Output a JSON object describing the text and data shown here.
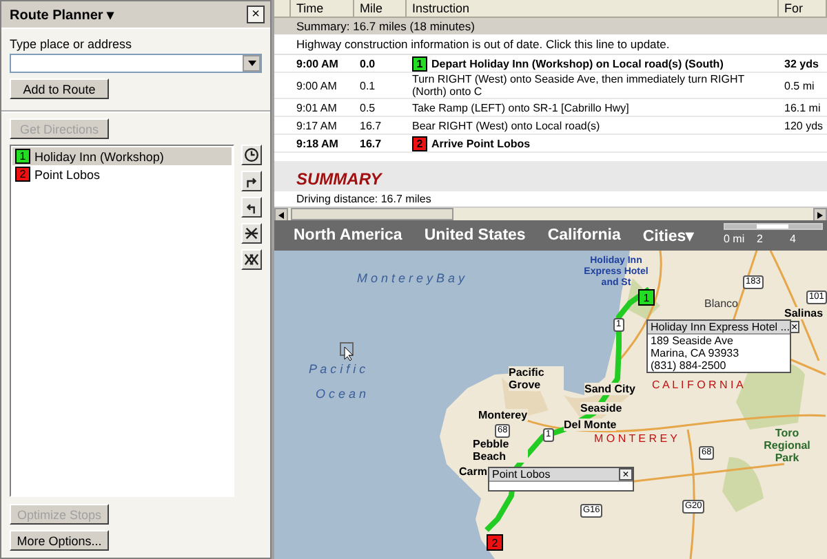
{
  "planner": {
    "title": "Route Planner",
    "menu_caret": "▾",
    "close": "×",
    "field_label": "Type place or address",
    "add_button": {
      "label": "Add to Route",
      "disabled": false
    },
    "directions_button": {
      "label": "Get Directions",
      "disabled": true
    },
    "stops": [
      {
        "number": "1",
        "name": "Holiday Inn (Workshop)",
        "color": "#22dd22",
        "selected": true
      },
      {
        "number": "2",
        "name": "Point Lobos",
        "color": "#ee1111",
        "selected": false
      }
    ],
    "bottom_buttons": [
      {
        "label": "Optimize Stops",
        "disabled": true
      },
      {
        "label": "More Options...",
        "disabled": false
      }
    ]
  },
  "directions": {
    "columns": [
      "Time",
      "Mile",
      "Instruction",
      "For"
    ],
    "summary": "Summary:  16.7 miles (18 minutes)",
    "notice": "Highway construction information is out of date.  Click this line to update.",
    "rows": [
      {
        "kind": "stop",
        "time": "9:00 AM",
        "mile": "0.0",
        "marker": "1",
        "color": "#22dd22",
        "instruction": "Depart Holiday Inn (Workshop) on Local road(s) (South)",
        "for": "32 yds"
      },
      {
        "kind": "step",
        "time": "9:00 AM",
        "mile": "0.1",
        "instruction": "Turn RIGHT (West) onto Seaside Ave, then immediately turn RIGHT (North) onto C",
        "for": "0.5 mi"
      },
      {
        "kind": "step",
        "time": "9:01 AM",
        "mile": "0.5",
        "instruction": "Take Ramp (LEFT) onto SR-1 [Cabrillo Hwy]",
        "for": "16.1 mi"
      },
      {
        "kind": "step",
        "time": "9:17 AM",
        "mile": "16.7",
        "instruction": "Bear RIGHT (West) onto Local road(s)",
        "for": "120 yds"
      },
      {
        "kind": "stop",
        "time": "9:18 AM",
        "mile": "16.7",
        "marker": "2",
        "color": "#ee1111",
        "instruction": "Arrive Point Lobos",
        "for": ""
      }
    ],
    "summary_heading": "SUMMARY",
    "distance": "Driving distance:  16.7 miles"
  },
  "map": {
    "breadcrumbs": [
      "North America",
      "United States",
      "California",
      "Cities▾"
    ],
    "scale": [
      "0 mi",
      "2",
      "4"
    ],
    "labels": [
      {
        "kind": "water",
        "text": "M o n t e r e y   B a y"
      },
      {
        "kind": "water",
        "text": "P a c i f i c"
      },
      {
        "kind": "water",
        "text": "O c e a n"
      },
      {
        "kind": "poi",
        "text": "Holiday Inn Express Hotel and St"
      },
      {
        "kind": "town",
        "text": "Blanco"
      },
      {
        "kind": "city",
        "text": "Salinas"
      },
      {
        "kind": "city",
        "text": "Pacific Grove"
      },
      {
        "kind": "region",
        "text": "C A L I F O R N I A"
      },
      {
        "kind": "city",
        "text": "Sand City"
      },
      {
        "kind": "city",
        "text": "Seaside"
      },
      {
        "kind": "city",
        "text": "Del Monte"
      },
      {
        "kind": "city",
        "text": "Monterey"
      },
      {
        "kind": "region",
        "text": "M O N T E R E Y"
      },
      {
        "kind": "city",
        "text": "Pebble Beach"
      },
      {
        "kind": "city",
        "text": "Carm"
      },
      {
        "kind": "park",
        "text": "Toro Regional Park"
      }
    ],
    "shields": [
      "1",
      "183",
      "101",
      "1",
      "68",
      "68",
      "G16",
      "G20"
    ],
    "markers": [
      {
        "number": "1",
        "color": "#22dd22"
      },
      {
        "number": "2",
        "color": "#ee1111"
      }
    ],
    "popups": [
      {
        "title": "Holiday Inn Express Hotel ...",
        "close": "×",
        "lines": [
          "189 Seaside Ave",
          "Marina, CA  93933",
          "(831) 884-2500"
        ]
      },
      {
        "title": "Point Lobos",
        "close": "×"
      }
    ]
  }
}
